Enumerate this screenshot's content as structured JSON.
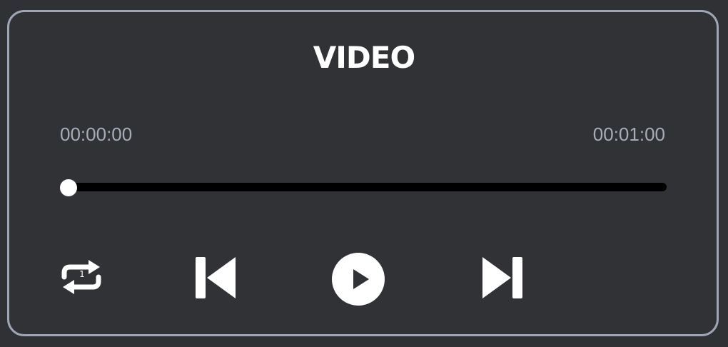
{
  "player": {
    "title": "VIDEO",
    "current_time": "00:00:00",
    "total_time": "00:01:00",
    "progress_fraction": 0.0,
    "repeat_badge": "1"
  },
  "icons": {
    "repeat": "repeat-one-icon",
    "previous": "skip-previous-icon",
    "play": "play-circle-icon",
    "next": "skip-next-icon"
  },
  "colors": {
    "background": "#303236",
    "border": "#9ea5b4",
    "text_primary": "#ffffff",
    "text_secondary": "#a7adb8",
    "track": "#000000",
    "thumb": "#ffffff"
  }
}
